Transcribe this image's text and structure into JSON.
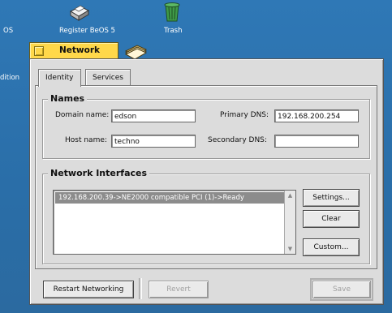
{
  "desktop": {
    "left_label": "OS",
    "register_label": "Register BeOS 5",
    "trash_label": "Trash",
    "edition_label": "dition"
  },
  "window": {
    "title": "Network",
    "tabs": [
      {
        "label": "Identity",
        "active": true
      },
      {
        "label": "Services",
        "active": false
      }
    ]
  },
  "names": {
    "title": "Names",
    "domain_label": "Domain name:",
    "domain_value": "edson",
    "host_label": "Host name:",
    "host_value": "techno",
    "primary_dns_label": "Primary DNS:",
    "primary_dns_value": "192.168.200.254",
    "secondary_dns_label": "Secondary DNS:",
    "secondary_dns_value": ""
  },
  "interfaces": {
    "title": "Network Interfaces",
    "items": [
      "192.168.200.39->NE2000 compatible PCI (1)->Ready"
    ],
    "settings_label": "Settings...",
    "clear_label": "Clear",
    "custom_label": "Custom..."
  },
  "footer": {
    "restart_label": "Restart Networking",
    "revert_label": "Revert",
    "save_label": "Save"
  }
}
